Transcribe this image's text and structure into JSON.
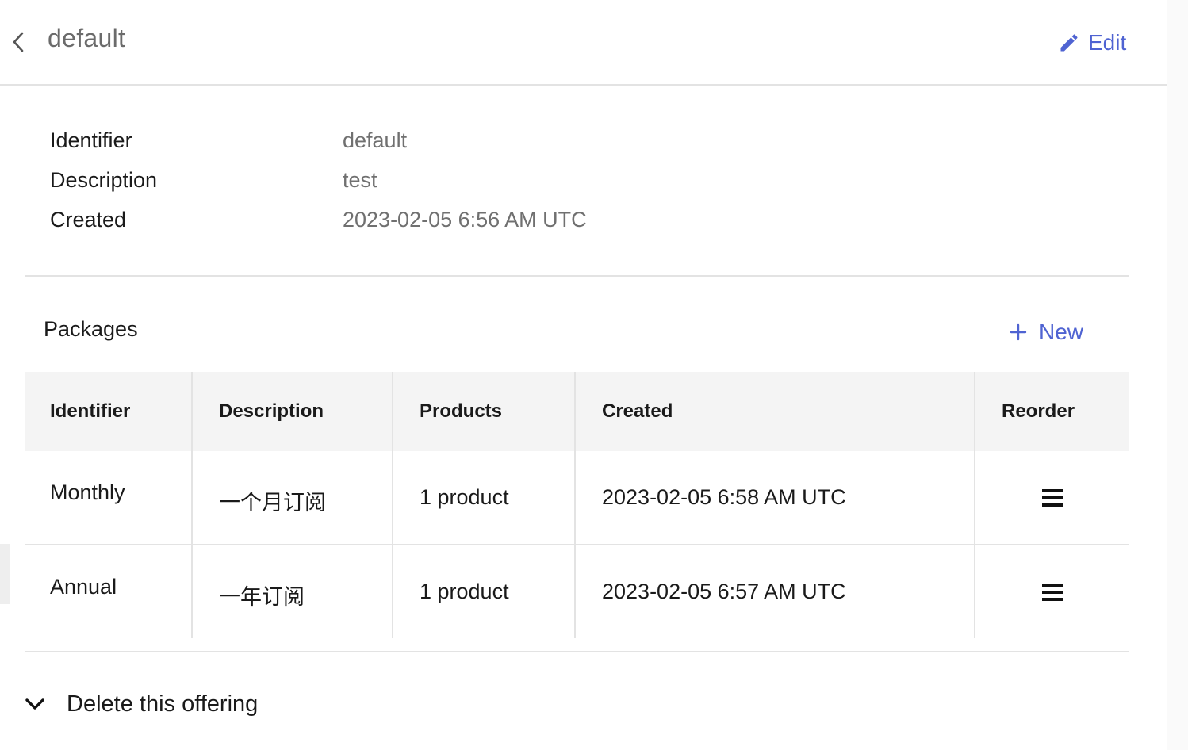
{
  "header": {
    "title": "default",
    "edit_label": "Edit"
  },
  "details": {
    "identifier_label": "Identifier",
    "identifier_value": "default",
    "description_label": "Description",
    "description_value": "test",
    "created_label": "Created",
    "created_value": "2023-02-05 6:56 AM UTC"
  },
  "packages": {
    "title": "Packages",
    "new_label": "New",
    "columns": [
      "Identifier",
      "Description",
      "Products",
      "Created",
      "Reorder"
    ],
    "rows": [
      {
        "identifier": "Monthly",
        "description": "一个月订阅",
        "products": "1 product",
        "created": "2023-02-05 6:58 AM UTC",
        "reorder_icon": "drag-handle-icon"
      },
      {
        "identifier": "Annual",
        "description": "一年订阅",
        "products": "1 product",
        "created": "2023-02-05 6:57 AM UTC",
        "reorder_icon": "drag-handle-icon"
      }
    ]
  },
  "danger": {
    "delete_label": "Delete this offering"
  },
  "colors": {
    "accent": "#4f63d2",
    "title_gray": "#6b6b6b",
    "value_gray": "#707070",
    "header_bg": "#f4f4f4",
    "divider": "#e3e3e3"
  }
}
